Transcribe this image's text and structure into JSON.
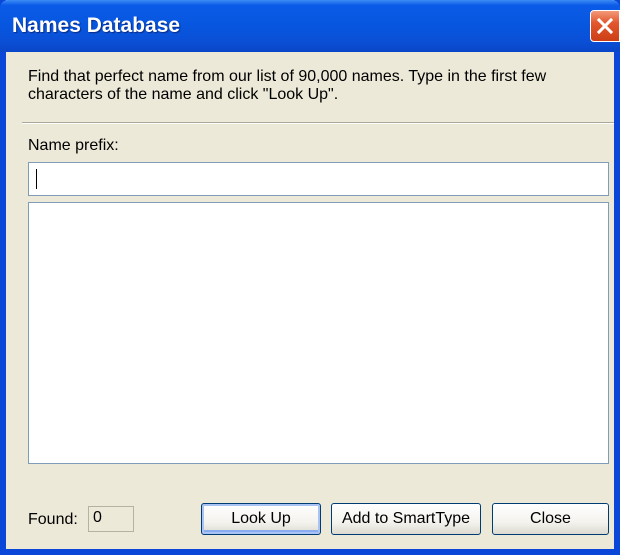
{
  "window": {
    "title": "Names Database"
  },
  "main": {
    "description": "Find that perfect name from our list of 90,000 names. Type in the first few characters of the name and click \"Look Up\".",
    "prefix_label": "Name prefix:",
    "prefix_value": "",
    "results": [],
    "found_label": "Found:",
    "found_count": "0"
  },
  "buttons": {
    "lookup": "Look Up",
    "add_smarttype": "Add to SmartType",
    "close": "Close"
  },
  "icons": {
    "close": "close-icon"
  },
  "colors": {
    "titlebar": "#0757e0",
    "close_button": "#e2572e",
    "dialog_bg": "#ece9d8"
  }
}
